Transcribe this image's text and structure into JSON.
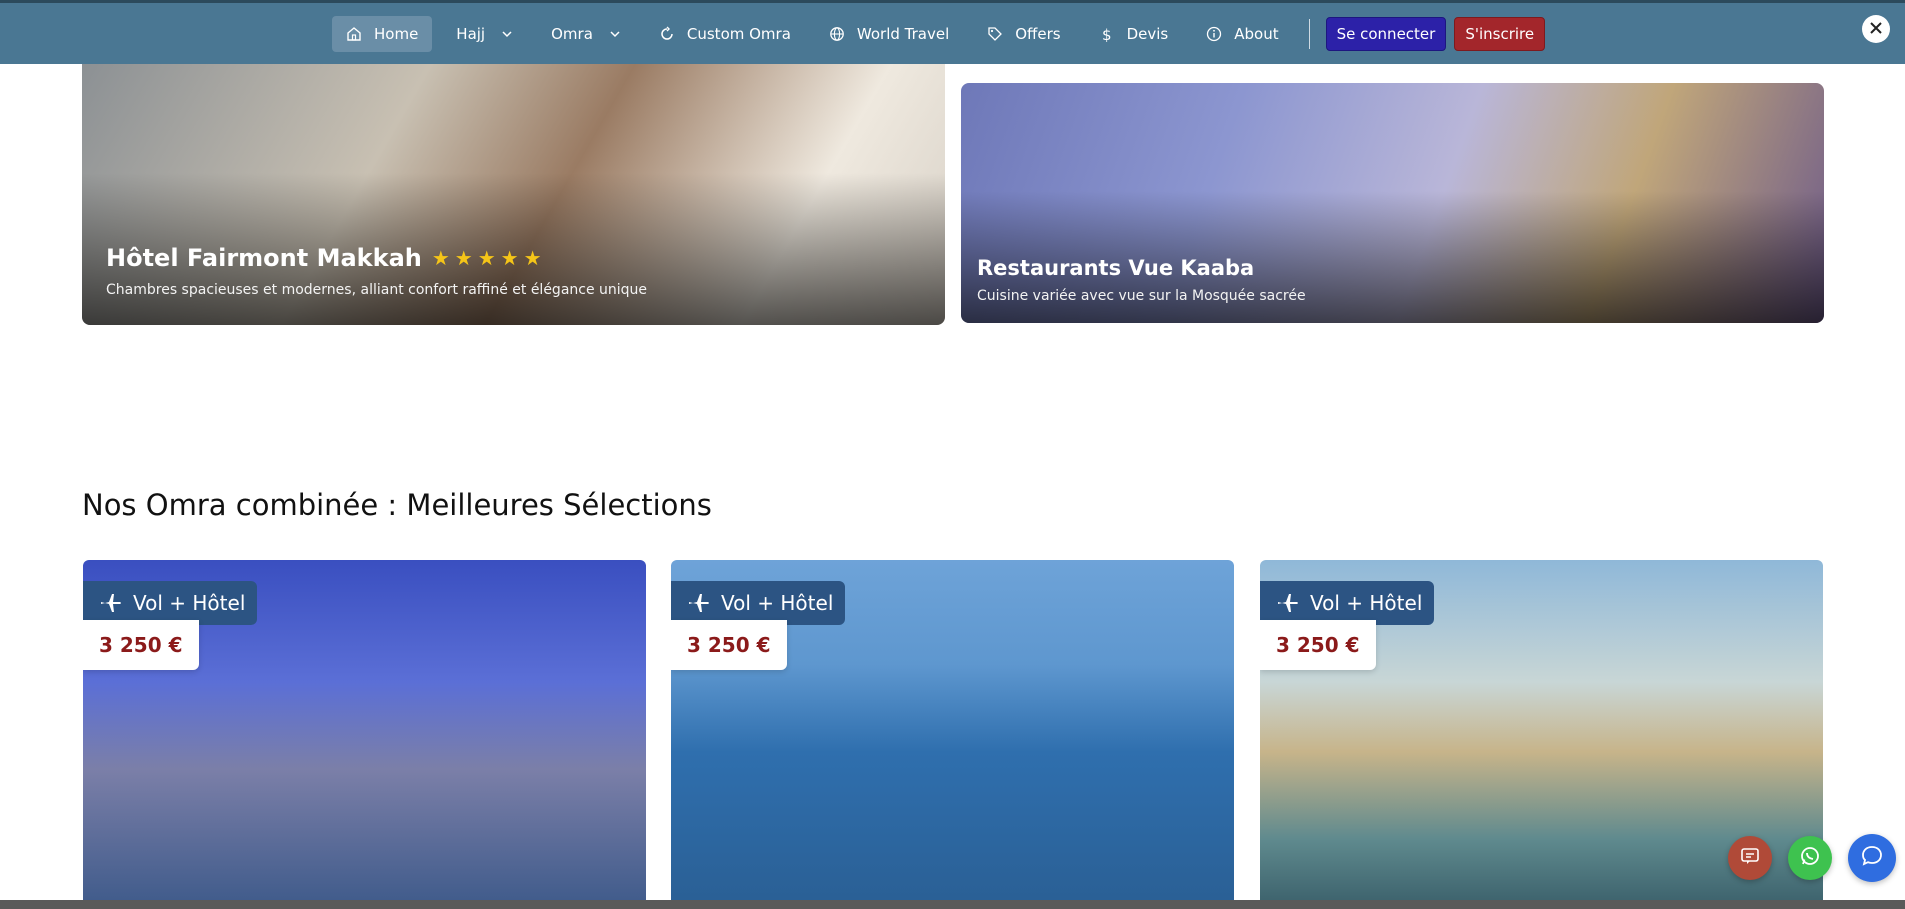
{
  "nav": {
    "items": [
      {
        "label": "Home",
        "icon": "home-icon"
      },
      {
        "label": "Hajj",
        "icon": "none"
      },
      {
        "label": "Omra",
        "icon": "none"
      },
      {
        "label": "Custom Omra",
        "icon": "refresh-icon"
      },
      {
        "label": "World Travel",
        "icon": "globe-icon"
      },
      {
        "label": "Offers",
        "icon": "tag-icon"
      },
      {
        "label": "Devis",
        "icon": "dollar-icon"
      },
      {
        "label": "About",
        "icon": "info-icon"
      }
    ],
    "login_label": "Se connecter",
    "register_label": "S'inscrire"
  },
  "features": {
    "hotel": {
      "title": "Hôtel Fairmont Makkah",
      "stars": 5,
      "description": "Chambres spacieuses et modernes, alliant confort raffiné et élégance unique"
    },
    "restaurant": {
      "title": "Restaurants Vue Kaaba",
      "description": "Cuisine variée avec vue sur la Mosquée sacrée"
    }
  },
  "section": {
    "title": "Nos Omra combinée : Meilleures Sélections"
  },
  "omra_cards": [
    {
      "badge": "Vol + Hôtel",
      "price": "3 250 €"
    },
    {
      "badge": "Vol + Hôtel",
      "price": "3 250 €"
    },
    {
      "badge": "Vol + Hôtel",
      "price": "3 250 €"
    }
  ],
  "colors": {
    "navbar": "#4a7793",
    "login_button": "#2c21a8",
    "register_button": "#a3262b",
    "badge": "#2c5483",
    "price": "#8b1a1a"
  }
}
